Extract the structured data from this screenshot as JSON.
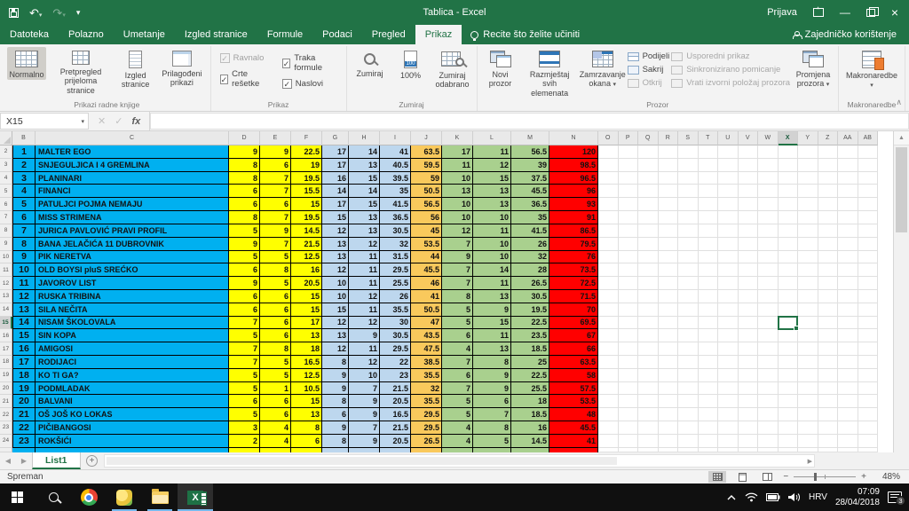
{
  "titlebar": {
    "title": "Tablica - Excel",
    "sign_in": "Prijava"
  },
  "menu": {
    "tabs": [
      "Datoteka",
      "Polazno",
      "Umetanje",
      "Izgled stranice",
      "Formule",
      "Podaci",
      "Pregled",
      "Prikaz"
    ],
    "active_tab": "Prikaz",
    "tell_me": "Recite što želite učiniti",
    "share": "Zajedničko korištenje"
  },
  "ribbon": {
    "workbook_views": {
      "label": "Prikazi radne knjige",
      "normal": "Normalno",
      "page_break": "Pretpregled prijeloma stranice",
      "page_layout": "Izgled stranice",
      "custom_views": "Prilagođeni prikazi"
    },
    "show": {
      "label": "Prikaz",
      "ruler": "Ravnalo",
      "gridlines": "Crte rešetke",
      "formula_bar": "Traka formule",
      "headings": "Naslovi"
    },
    "zoom": {
      "label": "Zumiraj",
      "zoom": "Zumiraj",
      "hundred": "100%",
      "zoom_selection": "Zumiraj odabrano"
    },
    "window": {
      "label": "Prozor",
      "new_window": "Novi prozor",
      "arrange_all": "Razmještaj svih elemenata",
      "freeze_panes": "Zamrzavanje okana",
      "split": "Podijeli",
      "hide": "Sakrij",
      "unhide": "Otkrij",
      "view_side": "Usporedni prikaz",
      "sync_scroll": "Sinkronizirano pomicanje",
      "reset_position": "Vrati izvorni položaj prozora",
      "switch_windows": "Promjena prozora"
    },
    "macros": {
      "label": "Makronaredbe",
      "button": "Makronaredbe"
    }
  },
  "formula_bar": {
    "name_box": "X15",
    "fx": "fx"
  },
  "sheet": {
    "col_headers": [
      "B",
      "C",
      "D",
      "E",
      "F",
      "G",
      "H",
      "I",
      "J",
      "K",
      "L",
      "M",
      "N",
      "O",
      "P",
      "Q",
      "R",
      "S",
      "T",
      "U",
      "V",
      "W",
      "X",
      "Y",
      "Z",
      "AA",
      "AB"
    ],
    "selected_col": "X",
    "selected_row": 15,
    "selected_cell": "X15",
    "rows": [
      {
        "n": 2,
        "rank": "1",
        "name": "MALTER EGO",
        "vals": [
          "9",
          "9",
          "22.5",
          "17",
          "14",
          "41",
          "63.5",
          "17",
          "11",
          "56.5",
          "120"
        ]
      },
      {
        "n": 3,
        "rank": "2",
        "name": "SNJEGULJICA I 4 GREMLINA",
        "vals": [
          "8",
          "6",
          "19",
          "17",
          "13",
          "40.5",
          "59.5",
          "11",
          "12",
          "39",
          "98.5"
        ]
      },
      {
        "n": 4,
        "rank": "3",
        "name": "PLANINARI",
        "vals": [
          "8",
          "7",
          "19.5",
          "16",
          "15",
          "39.5",
          "59",
          "10",
          "15",
          "37.5",
          "96.5"
        ]
      },
      {
        "n": 5,
        "rank": "4",
        "name": "FINANCI",
        "vals": [
          "6",
          "7",
          "15.5",
          "14",
          "14",
          "35",
          "50.5",
          "13",
          "13",
          "45.5",
          "96"
        ]
      },
      {
        "n": 6,
        "rank": "5",
        "name": "PATULJCI POJMA NEMAJU",
        "vals": [
          "6",
          "6",
          "15",
          "17",
          "15",
          "41.5",
          "56.5",
          "10",
          "13",
          "36.5",
          "93"
        ]
      },
      {
        "n": 7,
        "rank": "6",
        "name": "MISS STRIMENA",
        "vals": [
          "8",
          "7",
          "19.5",
          "15",
          "13",
          "36.5",
          "56",
          "10",
          "10",
          "35",
          "91"
        ]
      },
      {
        "n": 8,
        "rank": "7",
        "name": "JURICA PAVLOVIĆ PRAVI PROFIL",
        "vals": [
          "5",
          "9",
          "14.5",
          "12",
          "13",
          "30.5",
          "45",
          "12",
          "11",
          "41.5",
          "86.5"
        ]
      },
      {
        "n": 9,
        "rank": "8",
        "name": "BANA JELAČIĆA 11 DUBROVNIK",
        "vals": [
          "9",
          "7",
          "21.5",
          "13",
          "12",
          "32",
          "53.5",
          "7",
          "10",
          "26",
          "79.5"
        ]
      },
      {
        "n": 10,
        "rank": "9",
        "name": "PIK NERETVA",
        "vals": [
          "5",
          "5",
          "12.5",
          "13",
          "11",
          "31.5",
          "44",
          "9",
          "10",
          "32",
          "76"
        ]
      },
      {
        "n": 11,
        "rank": "10",
        "name": "OLD BOYSI pluS SREĆKO",
        "vals": [
          "6",
          "8",
          "16",
          "12",
          "11",
          "29.5",
          "45.5",
          "7",
          "14",
          "28",
          "73.5"
        ]
      },
      {
        "n": 12,
        "rank": "11",
        "name": "JAVOROV LIST",
        "vals": [
          "9",
          "5",
          "20.5",
          "10",
          "11",
          "25.5",
          "46",
          "7",
          "11",
          "26.5",
          "72.5"
        ]
      },
      {
        "n": 13,
        "rank": "12",
        "name": "RUSKA TRIBINA",
        "vals": [
          "6",
          "6",
          "15",
          "10",
          "12",
          "26",
          "41",
          "8",
          "13",
          "30.5",
          "71.5"
        ]
      },
      {
        "n": 14,
        "rank": "13",
        "name": "SILA NEČITA",
        "vals": [
          "6",
          "6",
          "15",
          "15",
          "11",
          "35.5",
          "50.5",
          "5",
          "9",
          "19.5",
          "70"
        ]
      },
      {
        "n": 15,
        "rank": "14",
        "name": "NISAM ŠKOLOVALA",
        "vals": [
          "7",
          "6",
          "17",
          "12",
          "12",
          "30",
          "47",
          "5",
          "15",
          "22.5",
          "69.5"
        ]
      },
      {
        "n": 16,
        "rank": "15",
        "name": "SIN KOPA",
        "vals": [
          "5",
          "6",
          "13",
          "13",
          "9",
          "30.5",
          "43.5",
          "6",
          "11",
          "23.5",
          "67"
        ]
      },
      {
        "n": 17,
        "rank": "16",
        "name": "AMIGOSI",
        "vals": [
          "7",
          "8",
          "18",
          "12",
          "11",
          "29.5",
          "47.5",
          "4",
          "13",
          "18.5",
          "66"
        ]
      },
      {
        "n": 18,
        "rank": "17",
        "name": "RODIJACI",
        "vals": [
          "7",
          "5",
          "16.5",
          "8",
          "12",
          "22",
          "38.5",
          "7",
          "8",
          "25",
          "63.5"
        ]
      },
      {
        "n": 19,
        "rank": "18",
        "name": "KO TI GA?",
        "vals": [
          "5",
          "5",
          "12.5",
          "9",
          "10",
          "23",
          "35.5",
          "6",
          "9",
          "22.5",
          "58"
        ]
      },
      {
        "n": 20,
        "rank": "19",
        "name": "PODMLADAK",
        "vals": [
          "5",
          "1",
          "10.5",
          "9",
          "7",
          "21.5",
          "32",
          "7",
          "9",
          "25.5",
          "57.5"
        ]
      },
      {
        "n": 21,
        "rank": "20",
        "name": "BALVANI",
        "vals": [
          "6",
          "6",
          "15",
          "8",
          "9",
          "20.5",
          "35.5",
          "5",
          "6",
          "18",
          "53.5"
        ]
      },
      {
        "n": 22,
        "rank": "21",
        "name": "OŠ JOŠ KO LOKAS",
        "vals": [
          "5",
          "6",
          "13",
          "6",
          "9",
          "16.5",
          "29.5",
          "5",
          "7",
          "18.5",
          "48"
        ]
      },
      {
        "n": 23,
        "rank": "22",
        "name": "PIČIBANGOSI",
        "vals": [
          "3",
          "4",
          "8",
          "9",
          "7",
          "21.5",
          "29.5",
          "4",
          "8",
          "16",
          "45.5"
        ]
      },
      {
        "n": 24,
        "rank": "23",
        "name": "ROKŠIĆI",
        "vals": [
          "2",
          "4",
          "6",
          "8",
          "9",
          "20.5",
          "26.5",
          "4",
          "5",
          "14.5",
          "41"
        ]
      }
    ]
  },
  "sheet_tabs": {
    "active": "List1"
  },
  "status_bar": {
    "mode": "Spreman",
    "zoom_out": "−",
    "zoom_in": "+",
    "zoom": "48%"
  },
  "taskbar": {
    "language": "HRV",
    "time": "07:09",
    "date": "28/04/2018",
    "notification_count": "3"
  },
  "colors": {
    "excel_green": "#217346",
    "cell_cyan": "#00b0f0",
    "cell_yellow": "#ffff00",
    "cell_light_blue": "#bdd7ee",
    "cell_gold": "#f9c95c",
    "cell_green": "#a9d08e",
    "cell_red": "#ff0000"
  }
}
